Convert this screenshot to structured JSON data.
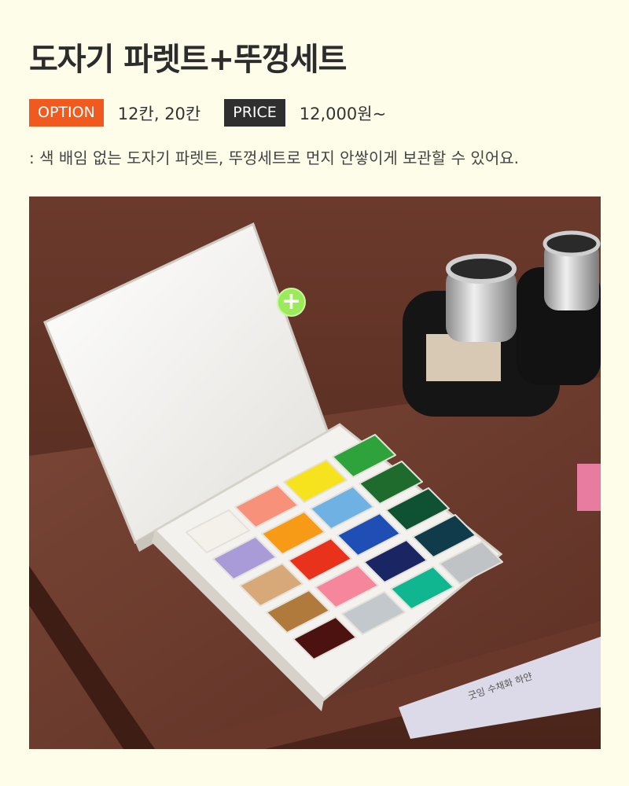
{
  "product": {
    "title": "도자기 파렛트+뚜껑세트",
    "option_tag": "OPTION",
    "option_value": "12칸, 20칸",
    "price_tag": "PRICE",
    "price_value": "12,000원~",
    "description": ": 색 배임 없는 도자기 파렛트, 뚜껑세트로 먼지 안쌓이게 보관할 수 있어요."
  },
  "photo": {
    "book_text": "굿잉 수채화 하얀",
    "hotspot_symbol": "+",
    "hotspot_color": "#9bea5a",
    "paint_colors": [
      "#f4f1ea",
      "#f7917a",
      "#f6e31d",
      "#2fa33b",
      "#a89bd8",
      "#f79b16",
      "#6fb1e3",
      "#1e6b2d",
      "#d7a878",
      "#e9321b",
      "#1f4fb5",
      "#0f5133",
      "#b07a3c",
      "#f5869b",
      "#1a2563",
      "#0f3b4a",
      "#4b1210",
      "#c3c8cc",
      "#0fb68f",
      "#bfc3c6"
    ]
  },
  "colors": {
    "background": "#fefde9",
    "option_tag_bg": "#f05a1e",
    "price_tag_bg": "#2f2f2f"
  }
}
